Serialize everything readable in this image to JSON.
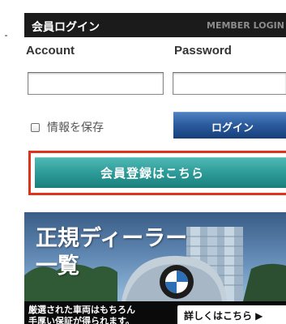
{
  "login": {
    "title": "会員ログイン",
    "subtitle": "MEMBER LOGIN",
    "account_label": "Account",
    "password_label": "Password",
    "account_value": "",
    "password_value": "",
    "save_label": "情報を保存",
    "save_checked": false,
    "login_button": "ログイン"
  },
  "register": {
    "button_label": "会員登録はこちら",
    "highlight_color": "#e0311c",
    "button_color": "#2d9b98"
  },
  "banner": {
    "title_line1": "正規ディーラー",
    "title_line2": "一覧",
    "caption_line1": "厳選された車両はもちろん",
    "caption_line2": "手厚い保証が得られます。",
    "details_button": "詳しくはこちら ▶"
  },
  "colors": {
    "header_bg": "#1b1b1b",
    "login_button": "#2c5c9e"
  }
}
